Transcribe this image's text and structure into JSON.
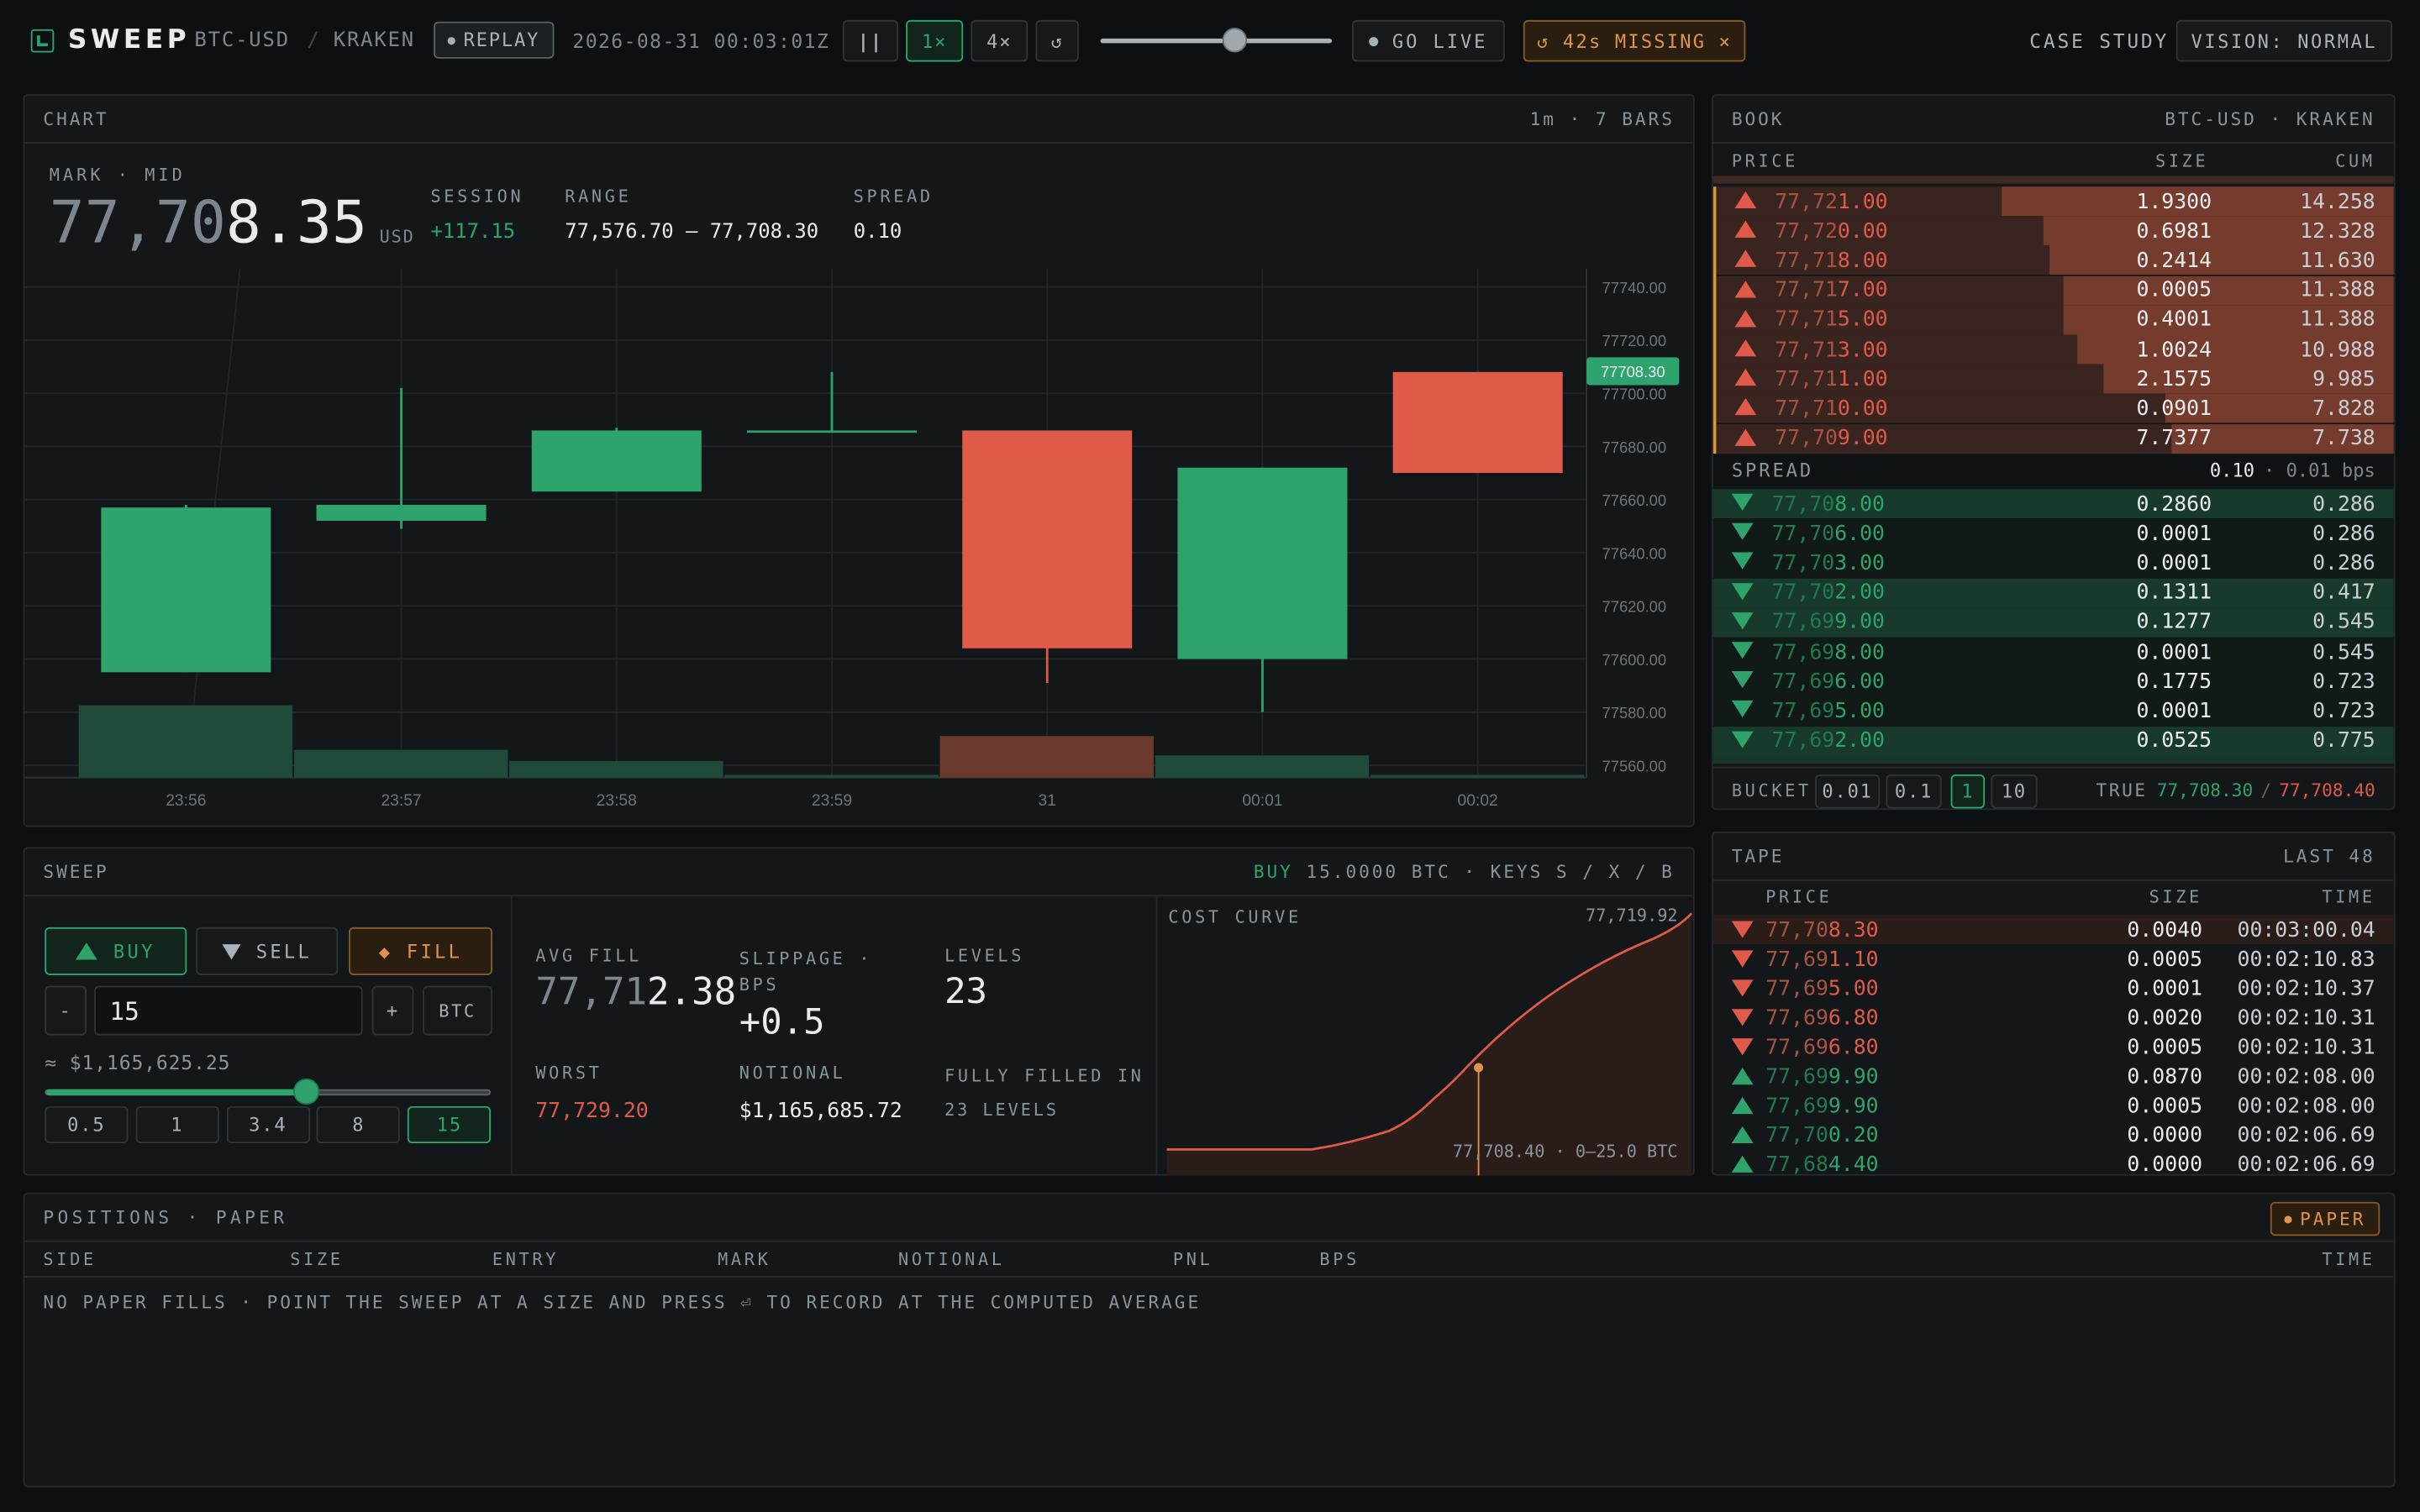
{
  "header": {
    "app_name": "SWEEP",
    "pair": "BTC-USD",
    "sep": "/",
    "exchange": "KRAKEN",
    "replay": "REPLAY",
    "timestamp": "2026-08-31 00:03:01Z",
    "pause": "||",
    "speed_1": "1×",
    "speed_4": "4×",
    "reset": "↺",
    "scrub_level": 0.58,
    "go_live": "GO LIVE",
    "missing": "↺ 42s MISSING ×",
    "case_study": "CASE STUDY",
    "vision": "VISION: NORMAL"
  },
  "chart_panel": {
    "title": "CHART",
    "meta": "1m · 7 BARS",
    "mark_label": "MARK · MID",
    "mark_dim": "77,70",
    "mark_bright": "8.35",
    "mark_unit": "USD",
    "session_label": "SESSION",
    "session_value": "+117.15",
    "range_label": "RANGE",
    "range_value": "77,576.70 – 77,708.30",
    "spread_label": "SPREAD",
    "spread_value": "0.10",
    "last_price_tag": "77708.30"
  },
  "chart_data": {
    "type": "candlestick",
    "title": "",
    "xlabel": "",
    "ylabel": "",
    "ylim": [
      77560,
      77740
    ],
    "yticks": [
      77740,
      77720,
      77700,
      77680,
      77660,
      77640,
      77620,
      77600,
      77580,
      77560
    ],
    "ytick_labels": [
      "77740.00",
      "77720.00",
      "77700.00",
      "77680.00",
      "77660.00",
      "77640.00",
      "77620.00",
      "77600.00",
      "77580.00",
      "77560.00"
    ],
    "categories": [
      "23:56",
      "23:57",
      "23:58",
      "23:59",
      "31",
      "00:01",
      "00:02"
    ],
    "candles": [
      {
        "t": "23:56",
        "open": 77595,
        "high": 77658,
        "low": 77595,
        "close": 77657
      },
      {
        "t": "23:57",
        "open": 77652,
        "high": 77702,
        "low": 77649,
        "close": 77658
      },
      {
        "t": "23:58",
        "open": 77663,
        "high": 77687,
        "low": 77663,
        "close": 77686
      },
      {
        "t": "23:59",
        "open": 77686,
        "high": 77708,
        "low": 77686,
        "close": 77686
      },
      {
        "t": "31",
        "open": 77686,
        "high": 77686,
        "low": 77591,
        "close": 77604
      },
      {
        "t": "00:01",
        "open": 77600,
        "high": 77672,
        "low": 77580,
        "close": 77672
      },
      {
        "t": "00:02",
        "open": 77708,
        "high": 77708,
        "low": 77670,
        "close": 77670
      }
    ],
    "volume": [
      0.26,
      0.1,
      0.06,
      0.01,
      0.15,
      0.08,
      0.01
    ],
    "volume_colors": [
      "#1f4b38",
      "#1f4b38",
      "#1f4b38",
      "#1f4b38",
      "#6a3a2c",
      "#1f4b38",
      "#1f4b38"
    ],
    "last_price": 77708.3,
    "grid": true
  },
  "book": {
    "title": "BOOK",
    "meta": "BTC-USD · KRAKEN",
    "col_price": "PRICE",
    "col_size": "SIZE",
    "col_cum": "CUM",
    "asks": [
      {
        "dim": "77,72",
        "hi": "1.00",
        "size": "1.9300",
        "cum": "14.258",
        "depth": 0.58
      },
      {
        "dim": "77,72",
        "hi": "0.00",
        "size": "0.6981",
        "cum": "12.328",
        "depth": 0.52
      },
      {
        "dim": "77,71",
        "hi": "8.00",
        "size": "0.2414",
        "cum": "11.630",
        "depth": 0.51
      },
      {
        "dim": "77,71",
        "hi": "7.00",
        "size": "0.0005",
        "cum": "11.388",
        "depth": 0.49
      },
      {
        "dim": "77,71",
        "hi": "5.00",
        "size": "0.4001",
        "cum": "11.388",
        "depth": 0.49
      },
      {
        "dim": "77,71",
        "hi": "3.00",
        "size": "1.0024",
        "cum": "10.988",
        "depth": 0.47
      },
      {
        "dim": "77,71",
        "hi": "1.00",
        "size": "2.1575",
        "cum": "9.985",
        "depth": 0.43
      },
      {
        "dim": "77,71",
        "hi": "0.00",
        "size": "0.0901",
        "cum": "7.828",
        "depth": 0.34
      },
      {
        "dim": "77,70",
        "hi": "9.00",
        "size": "7.7377",
        "cum": "7.738",
        "depth": 0.33
      }
    ],
    "spread_label": "SPREAD",
    "spread_value": "0.10",
    "spread_bps": "· 0.01 bps",
    "bids": [
      {
        "dim": "77,70",
        "hi": "8.00",
        "size": "0.2860",
        "cum": "0.286",
        "hl": true
      },
      {
        "dim": "77,70",
        "hi": "6.00",
        "size": "0.0001",
        "cum": "0.286",
        "hl": false
      },
      {
        "dim": "77,70",
        "hi": "3.00",
        "size": "0.0001",
        "cum": "0.286",
        "hl": false
      },
      {
        "dim": "77,70",
        "hi": "2.00",
        "size": "0.1311",
        "cum": "0.417",
        "hl": true
      },
      {
        "dim": "77,69",
        "hi": "9.00",
        "size": "0.1277",
        "cum": "0.545",
        "hl": true
      },
      {
        "dim": "77,69",
        "hi": "8.00",
        "size": "0.0001",
        "cum": "0.545",
        "hl": false
      },
      {
        "dim": "77,69",
        "hi": "6.00",
        "size": "0.1775",
        "cum": "0.723",
        "hl": false
      },
      {
        "dim": "77,69",
        "hi": "5.00",
        "size": "0.0001",
        "cum": "0.723",
        "hl": false
      },
      {
        "dim": "77,69",
        "hi": "2.00",
        "size": "0.0525",
        "cum": "0.775",
        "hl": true
      }
    ],
    "bucket_label": "BUCKET",
    "buckets": [
      "0.01",
      "0.1",
      "1",
      "10"
    ],
    "true_label": "TRUE",
    "true_bid": "77,708.30",
    "true_sep": "/",
    "true_ask": "77,708.40"
  },
  "sweep": {
    "title": "SWEEP",
    "meta_buy": "BUY",
    "meta_rest": "15.0000 BTC · KEYS S / X / B",
    "buy": "BUY",
    "sell": "SELL",
    "fill": "◆ FILL",
    "minus": "-",
    "plus": "+",
    "qty": "15",
    "unit": "BTC",
    "approx": "≈ $1,165,625.25",
    "slider_level": 0.59,
    "presets": [
      "0.5",
      "1",
      "3.4",
      "8",
      "15"
    ],
    "avg_label": "AVG FILL",
    "avg_dim": "77,71",
    "avg_hi": "2.38",
    "slip_label": "SLIPPAGE · BPS",
    "slip_value": "+0.5",
    "levels_label": "LEVELS",
    "levels_value": "23",
    "worst_label": "WORST",
    "worst_value": "77,729.20",
    "notional_label": "NOTIONAL",
    "notional_value": "$1,165,685.72",
    "filled_label": "FULLY FILLED IN",
    "filled_value": "23 LEVELS",
    "curve_label": "COST CURVE",
    "curve_top": "77,719.92",
    "curve_bottom": "77,708.40 · 0–25.0 BTC"
  },
  "tape": {
    "title": "TAPE",
    "meta": "LAST 48",
    "col_price": "PRICE",
    "col_size": "SIZE",
    "col_time": "TIME",
    "rows": [
      {
        "side": "sell",
        "dim": "77,70",
        "hi": "8.30",
        "size": "0.0040",
        "time": "00:03:00.04"
      },
      {
        "side": "sell",
        "dim": "77,69",
        "hi": "1.10",
        "size": "0.0005",
        "time": "00:02:10.83"
      },
      {
        "side": "sell",
        "dim": "77,69",
        "hi": "5.00",
        "size": "0.0001",
        "time": "00:02:10.37"
      },
      {
        "side": "sell",
        "dim": "77,69",
        "hi": "6.80",
        "size": "0.0020",
        "time": "00:02:10.31"
      },
      {
        "side": "sell",
        "dim": "77,69",
        "hi": "6.80",
        "size": "0.0005",
        "time": "00:02:10.31"
      },
      {
        "side": "buy",
        "dim": "77,69",
        "hi": "9.90",
        "size": "0.0870",
        "time": "00:02:08.00"
      },
      {
        "side": "buy",
        "dim": "77,69",
        "hi": "9.90",
        "size": "0.0005",
        "time": "00:02:08.00"
      },
      {
        "side": "buy",
        "dim": "77,70",
        "hi": "0.20",
        "size": "0.0000",
        "time": "00:02:06.69"
      },
      {
        "side": "buy",
        "dim": "77,68",
        "hi": "4.40",
        "size": "0.0000",
        "time": "00:02:06.69"
      }
    ]
  },
  "positions": {
    "title": "POSITIONS · PAPER",
    "badge": "PAPER",
    "cols": [
      "SIDE",
      "SIZE",
      "ENTRY",
      "MARK",
      "NOTIONAL",
      "PNL",
      "BPS",
      "TIME"
    ],
    "empty": "NO PAPER FILLS · POINT THE SWEEP AT A SIZE AND PRESS ⏎ TO RECORD AT THE COMPUTED AVERAGE"
  },
  "colors": {
    "green": "#2ea36b",
    "red": "#e05a4a",
    "orange": "#e0934a",
    "bg": "#0d1013",
    "panel": "#131719"
  }
}
